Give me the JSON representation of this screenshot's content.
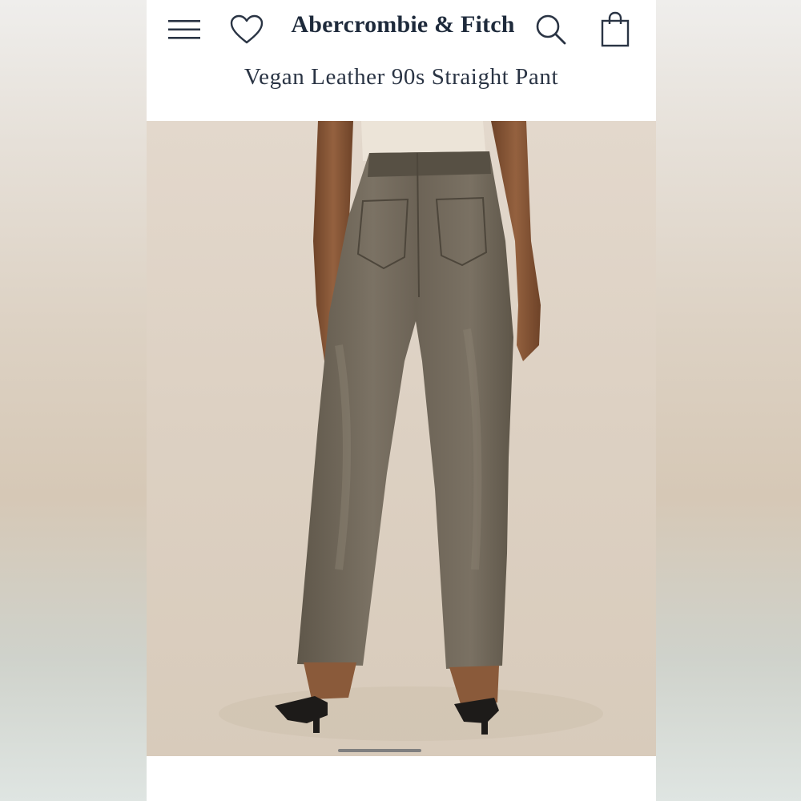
{
  "header": {
    "brand": "Abercrombie & Fitch",
    "menu_icon": "hamburger-menu-icon",
    "wishlist_icon": "heart-icon",
    "search_icon": "search-icon",
    "bag_icon": "shopping-bag-icon"
  },
  "product": {
    "title": "Vegan Leather 90s Straight Pant",
    "image_subject": "product-photo"
  },
  "colors": {
    "brand_text": "#1e2a3b",
    "hero_background": "#ddd1c3",
    "pant_color": "#6f6658",
    "top_color": "#ece4d8",
    "skin_color": "#8a5a3a"
  },
  "carousel": {
    "indicator": "scroll-indicator"
  }
}
